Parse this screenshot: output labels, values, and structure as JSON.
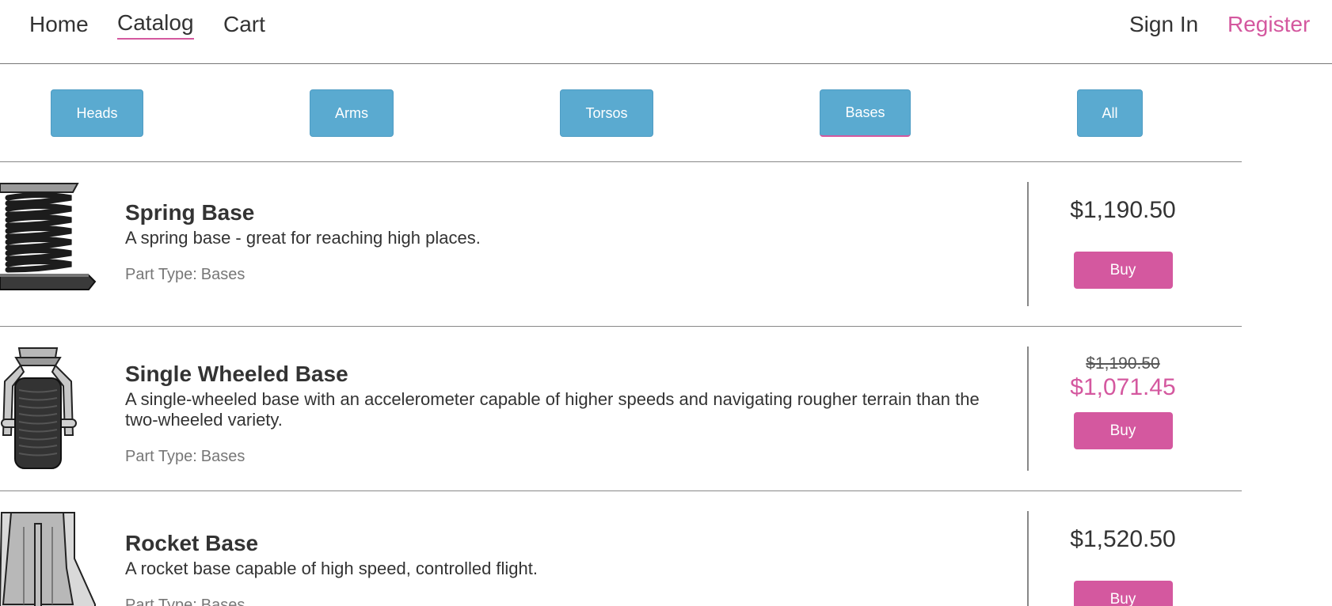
{
  "nav": {
    "home": "Home",
    "catalog": "Catalog",
    "cart": "Cart",
    "sign_in": "Sign In",
    "register": "Register"
  },
  "filters": {
    "heads": "Heads",
    "arms": "Arms",
    "torsos": "Torsos",
    "bases": "Bases",
    "all": "All",
    "active": "Bases"
  },
  "products": [
    {
      "name": "Spring Base",
      "description": "A spring base - great for reaching high places.",
      "part_type_label": "Part Type:",
      "part_type": "Bases",
      "price": "$1,190.50",
      "buy_label": "Buy",
      "image_icon": "spring-base-image"
    },
    {
      "name": "Single Wheeled Base",
      "description": "A single-wheeled base with an accelerometer capable of higher speeds and navigating rougher terrain than the two-wheeled variety.",
      "part_type_label": "Part Type:",
      "part_type": "Bases",
      "original_price": "$1,190.50",
      "sale_price": "$1,071.45",
      "buy_label": "Buy",
      "image_icon": "single-wheeled-base-image"
    },
    {
      "name": "Rocket Base",
      "description": "A rocket base capable of high speed, controlled flight.",
      "part_type_label": "Part Type:",
      "part_type": "Bases",
      "price": "$1,520.50",
      "buy_label": "Buy",
      "image_icon": "rocket-base-image"
    }
  ],
  "colors": {
    "accent": "#d4589f",
    "filter_button": "#5aaad0",
    "text": "#333333",
    "muted_text": "#777777"
  }
}
